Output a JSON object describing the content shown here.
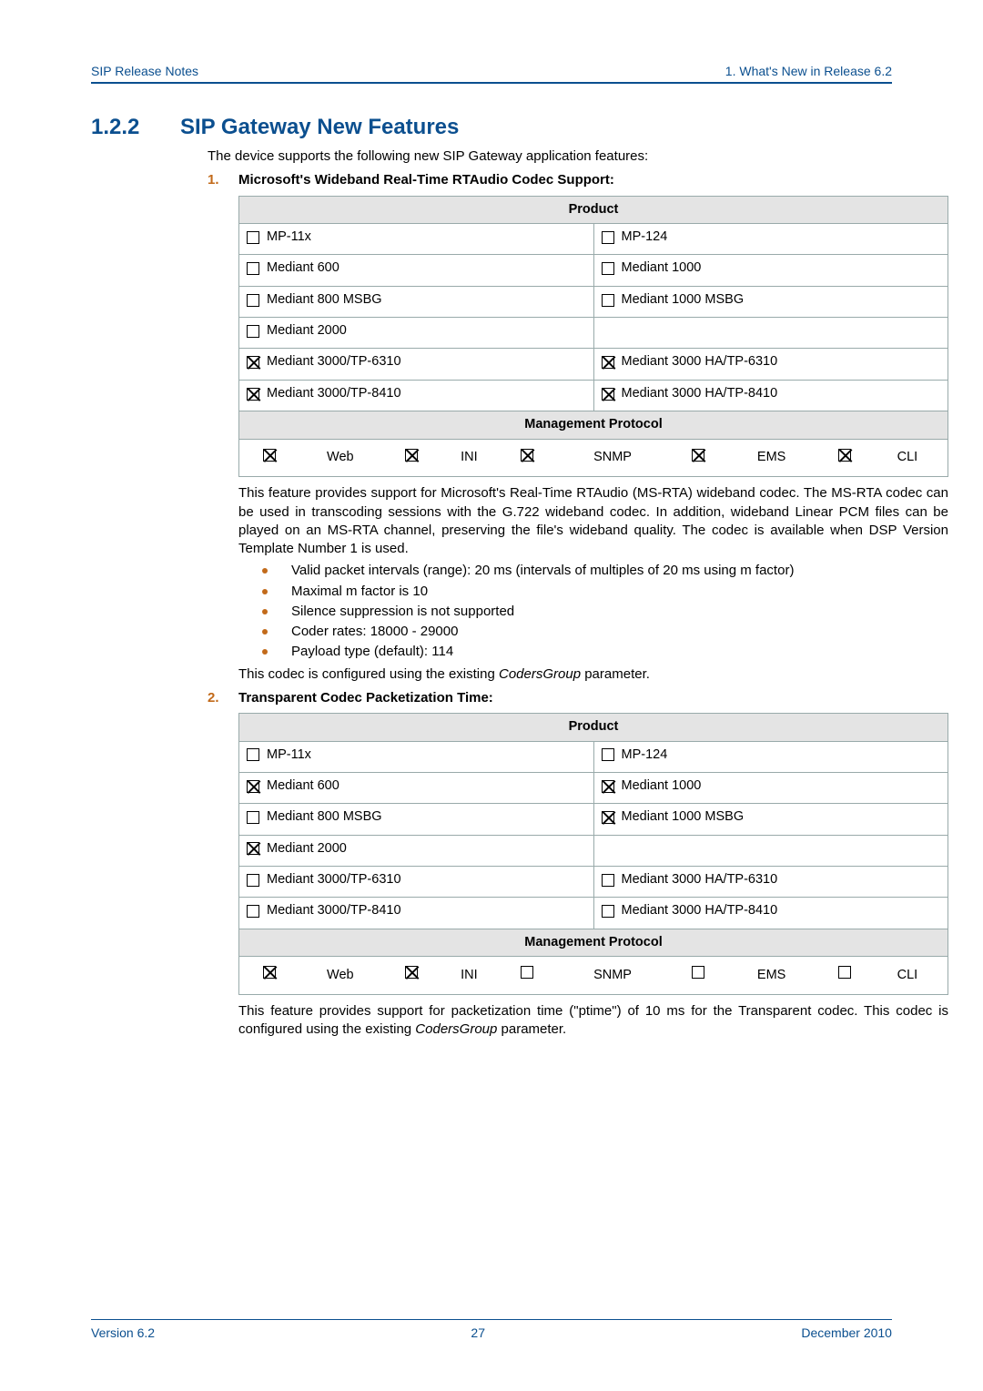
{
  "header": {
    "left": "SIP Release Notes",
    "right": "1. What's New in Release 6.2"
  },
  "section": {
    "number": "1.2.2",
    "title": "SIP Gateway New Features",
    "intro": "The device supports the following new SIP Gateway application features:"
  },
  "item1": {
    "num": "1.",
    "title": "Microsoft's Wideband Real-Time RTAudio Codec Support:",
    "product_hdr": "Product",
    "rows": [
      [
        {
          "checked": false,
          "label": "MP-11x"
        },
        {
          "checked": false,
          "label": "MP-124"
        }
      ],
      [
        {
          "checked": false,
          "label": "Mediant 600"
        },
        {
          "checked": false,
          "label": "Mediant 1000"
        }
      ],
      [
        {
          "checked": false,
          "label": "Mediant 800 MSBG"
        },
        {
          "checked": false,
          "label": "Mediant 1000 MSBG"
        }
      ],
      [
        {
          "checked": false,
          "label": "Mediant 2000"
        },
        null
      ],
      [
        {
          "checked": true,
          "label": "Mediant 3000/TP-6310"
        },
        {
          "checked": true,
          "label": "Mediant 3000 HA/TP-6310"
        }
      ],
      [
        {
          "checked": true,
          "label": "Mediant 3000/TP-8410"
        },
        {
          "checked": true,
          "label": "Mediant 3000 HA/TP-8410"
        }
      ]
    ],
    "mgmt_hdr": "Management Protocol",
    "mgmt": [
      {
        "checked": true,
        "label": "Web"
      },
      {
        "checked": true,
        "label": "INI"
      },
      {
        "checked": true,
        "label": "SNMP"
      },
      {
        "checked": true,
        "label": "EMS"
      },
      {
        "checked": true,
        "label": "CLI"
      }
    ],
    "para": "This feature provides support for Microsoft's Real-Time RTAudio (MS-RTA) wideband codec. The MS-RTA codec can be used in transcoding sessions with the G.722 wideband codec. In addition, wideband Linear PCM files can be played on an MS-RTA channel, preserving the file's wideband quality. The codec is available when DSP Version Template Number 1 is used.",
    "bullets": [
      "Valid packet intervals (range): 20 ms (intervals of multiples of 20 ms using m factor)",
      "Maximal m factor is 10",
      "Silence suppression is not supported",
      "Coder rates: 18000 - 29000",
      "Payload type (default): 114"
    ],
    "para2_prefix": "This codec is configured using the existing ",
    "para2_ital": "CodersGroup",
    "para2_suffix": " parameter."
  },
  "item2": {
    "num": "2.",
    "title": "Transparent Codec Packetization Time:",
    "product_hdr": "Product",
    "rows": [
      [
        {
          "checked": false,
          "label": "MP-11x"
        },
        {
          "checked": false,
          "label": "MP-124"
        }
      ],
      [
        {
          "checked": true,
          "label": "Mediant 600"
        },
        {
          "checked": true,
          "label": "Mediant 1000"
        }
      ],
      [
        {
          "checked": false,
          "label": "Mediant 800 MSBG"
        },
        {
          "checked": true,
          "label": "Mediant 1000 MSBG"
        }
      ],
      [
        {
          "checked": true,
          "label": "Mediant 2000"
        },
        null
      ],
      [
        {
          "checked": false,
          "label": "Mediant 3000/TP-6310"
        },
        {
          "checked": false,
          "label": "Mediant 3000 HA/TP-6310"
        }
      ],
      [
        {
          "checked": false,
          "label": "Mediant 3000/TP-8410"
        },
        {
          "checked": false,
          "label": "Mediant 3000 HA/TP-8410"
        }
      ]
    ],
    "mgmt_hdr": "Management Protocol",
    "mgmt": [
      {
        "checked": true,
        "label": "Web"
      },
      {
        "checked": true,
        "label": "INI"
      },
      {
        "checked": false,
        "label": "SNMP"
      },
      {
        "checked": false,
        "label": "EMS"
      },
      {
        "checked": false,
        "label": "CLI"
      }
    ],
    "para_prefix": "This feature provides support for packetization time (\"ptime\") of 10 ms for the Transparent codec. This codec is configured using the existing ",
    "para_ital": "CodersGroup",
    "para_suffix": " parameter."
  },
  "footer": {
    "left": "Version 6.2",
    "center": "27",
    "right": "December 2010"
  }
}
